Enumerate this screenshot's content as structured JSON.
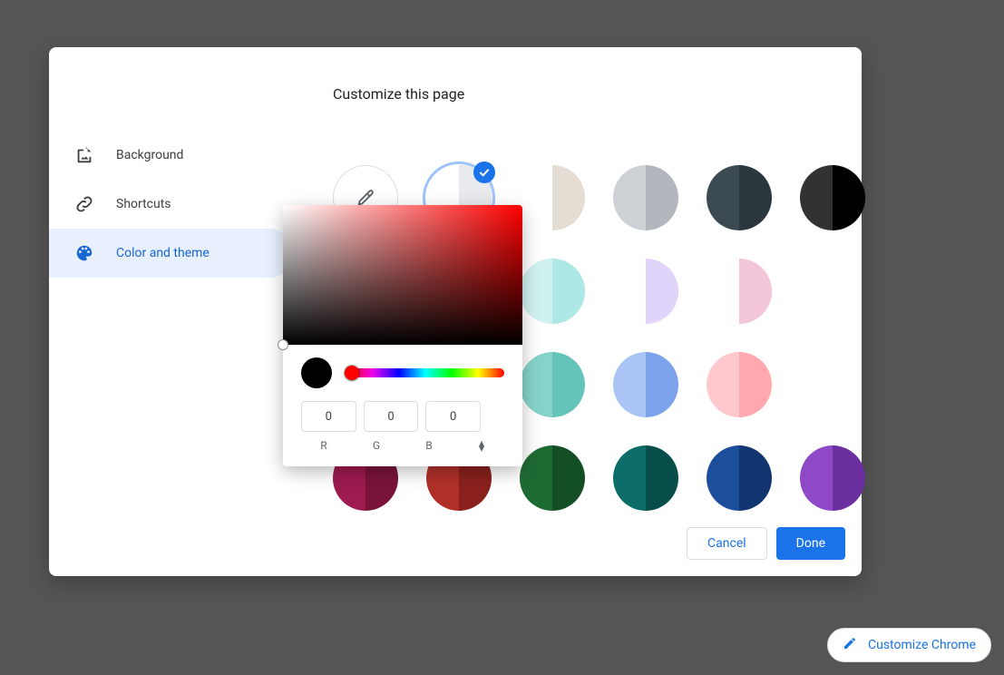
{
  "title": "Customize this page",
  "sidebar": [
    {
      "icon": "image-icon",
      "label": "Background"
    },
    {
      "icon": "link-icon",
      "label": "Shortcuts"
    },
    {
      "icon": "palette-icon",
      "label": "Color and theme",
      "selected": true
    }
  ],
  "selectedSwatchIndex": 1,
  "swatches": [
    {
      "picker": true
    },
    {
      "left": "#ffffff",
      "right": "#e8eaed"
    },
    {
      "left": "#ffffff",
      "right": "#e5ddd3",
      "border": true
    },
    {
      "left": "#cdd0d5",
      "right": "#b3b7bd"
    },
    {
      "left": "#3b4a51",
      "right": "#2b373d"
    },
    {
      "left": "#323232",
      "right": "#000000"
    },
    {
      "left": "#e2f1c6",
      "right": "#bfe389"
    },
    {
      "left": "#94cf9d",
      "right": "#76c482"
    },
    {
      "left": "#cff1ef",
      "right": "#aee8e6",
      "border": true
    },
    {
      "left": "#ffffff",
      "right": "#e1d4fb",
      "border": true
    },
    {
      "left": "#ffffff",
      "right": "#f4c6da",
      "border": true
    },
    null,
    {
      "left": "#5fc27e",
      "right": "#3da35d"
    },
    {
      "left": "#6bb49f",
      "right": "#4d9d85"
    },
    {
      "left": "#86d3ca",
      "right": "#64c4b9"
    },
    {
      "left": "#a9c4f5",
      "right": "#7ca2ec"
    },
    {
      "left": "#ffc8cc",
      "right": "#ffa9ae"
    },
    null,
    {
      "left": "#9d1b4f",
      "right": "#7a133c"
    },
    {
      "left": "#b03029",
      "right": "#8a211d"
    },
    {
      "left": "#1e6a33",
      "right": "#134e24"
    },
    {
      "left": "#0d6e69",
      "right": "#074e4a"
    },
    {
      "left": "#1b4e9b",
      "right": "#11356f"
    },
    {
      "left": "#8f48c7",
      "right": "#6b2fa0"
    }
  ],
  "picker": {
    "r": "0",
    "g": "0",
    "b": "0",
    "labR": "R",
    "labG": "G",
    "labB": "B"
  },
  "buttons": {
    "cancel": "Cancel",
    "done": "Done"
  },
  "chip": "Customize Chrome"
}
